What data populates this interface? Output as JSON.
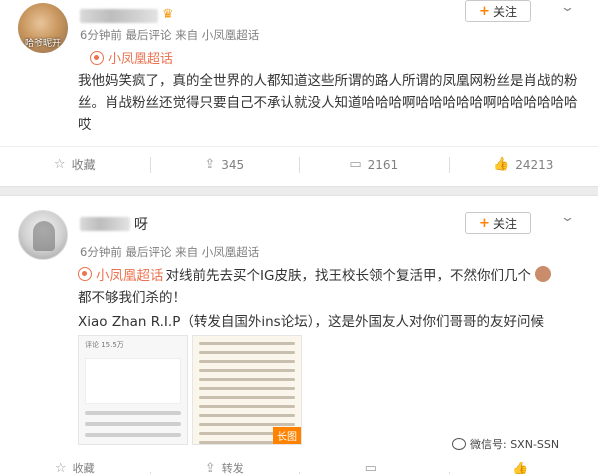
{
  "post1": {
    "avatar_caption": "哈爷昵开",
    "meta": "6分钟前 最后评论 来自 小凤凰超话",
    "follow_label": "关注",
    "topic": "小凤凰超话",
    "body": "我他妈笑疯了，真的全世界的人都知道这些所谓的路人所谓的凤凰网粉丝是肖战的粉丝。肖战粉丝还觉得只要自己不承认就没人知道哈哈哈啊哈哈哈哈哈啊哈哈哈哈哈哈哎",
    "actions": [
      {
        "icon": "star-icon",
        "glyph": "☆",
        "label": "收藏"
      },
      {
        "icon": "share-icon",
        "glyph": "⇪",
        "label": "345"
      },
      {
        "icon": "comment-icon",
        "glyph": "▭",
        "label": "2161"
      },
      {
        "icon": "like-icon",
        "glyph": "👍",
        "label": "24213"
      }
    ]
  },
  "post2": {
    "name_suffix": "呀",
    "meta": "6分钟前 最后评论 来自 小凤凰超话",
    "follow_label": "关注",
    "topic": "小凤凰超话",
    "line1_rest": "对线前先去买个IG皮肤，找王校长领个复活甲，不然你们几个",
    "line2": "都不够我们杀的！",
    "line3": "Xiao Zhan R.I.P（转发自国外ins论坛），这是外国友人对你们哥哥的友好问候",
    "thumb1_header": "评论 15.5万",
    "long_tag": "长图",
    "actions": [
      {
        "icon": "star-icon",
        "glyph": "☆",
        "label": "收藏"
      },
      {
        "icon": "share-icon",
        "glyph": "⇪",
        "label": "转发"
      },
      {
        "icon": "comment-icon",
        "glyph": "▭",
        "label": ""
      },
      {
        "icon": "like-icon",
        "glyph": "👍",
        "label": ""
      }
    ]
  },
  "watermark": "微信号: SXN-SSN",
  "colors": {
    "accent": "#ff8200",
    "topic": "#eb7350",
    "meta": "#808080"
  }
}
